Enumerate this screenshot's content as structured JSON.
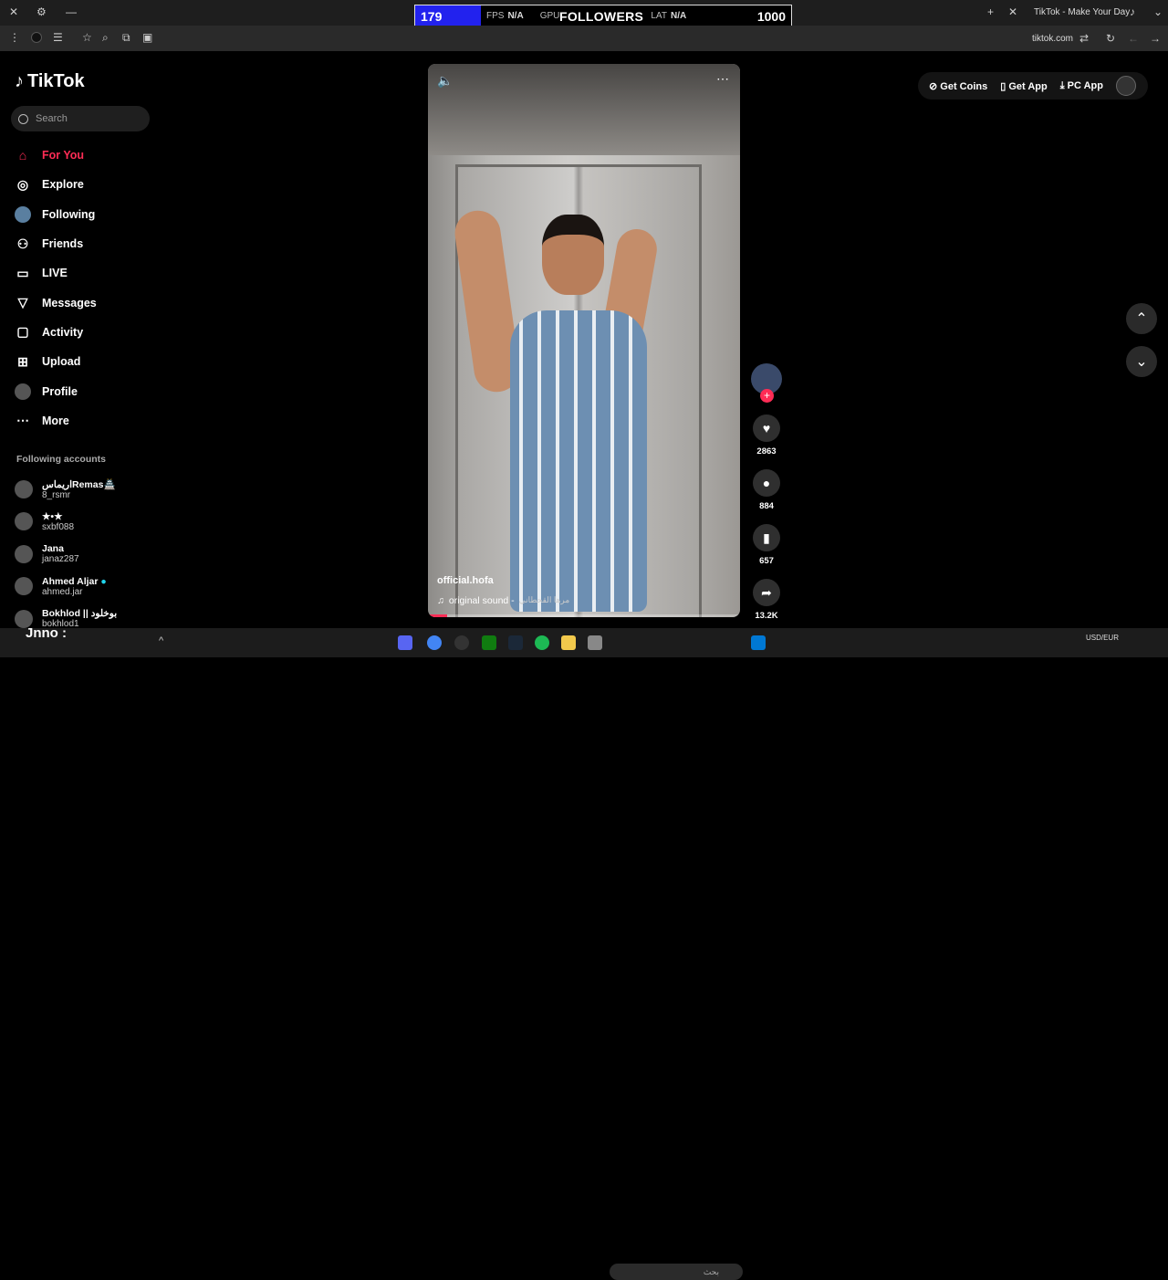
{
  "overlay": {
    "count": "179",
    "fps_label": "FPS",
    "fps_value": "N/A",
    "gpu_label": "GPU",
    "title": "FOLLOWERS",
    "lat_label": "LAT",
    "lat_value": "N/A",
    "goal": "1000"
  },
  "browser": {
    "tab_title": "TikTok - Make Your Day",
    "url": "tiktok.com"
  },
  "brand": {
    "name": "TikTok"
  },
  "search": {
    "placeholder": "Search"
  },
  "nav": [
    {
      "label": "For You",
      "icon": "home-icon"
    },
    {
      "label": "Explore",
      "icon": "compass-icon"
    },
    {
      "label": "Following",
      "icon": "following-avatar-icon"
    },
    {
      "label": "Friends",
      "icon": "friends-icon"
    },
    {
      "label": "LIVE",
      "icon": "live-tv-icon"
    },
    {
      "label": "Messages",
      "icon": "send-icon"
    },
    {
      "label": "Activity",
      "icon": "activity-icon"
    },
    {
      "label": "Upload",
      "icon": "plus-square-icon"
    },
    {
      "label": "Profile",
      "icon": "profile-avatar-icon"
    },
    {
      "label": "More",
      "icon": "more-icon"
    }
  ],
  "following_accounts": {
    "heading": "Following accounts",
    "items": [
      {
        "name": "اريماسRemas🏯",
        "user": "8_rsmr"
      },
      {
        "name": "★•★",
        "user": "sxbf088"
      },
      {
        "name": "Jana",
        "user": "janaz287"
      },
      {
        "name": "Ahmed Aljar",
        "user": "ahmed.jar"
      },
      {
        "name": "Bokhlod || بوخلود",
        "user": "bokhlod1"
      }
    ]
  },
  "video": {
    "author": "official.hofa",
    "sound": "original sound -",
    "sound_extra": "مرها القحطاني",
    "progress": 0.06
  },
  "actions": {
    "likes": "2863",
    "comments": "884",
    "saves": "657",
    "shares": "13.2K"
  },
  "top_actions": {
    "coins": "Get Coins",
    "app": "Get App",
    "pc": "PC App"
  },
  "taskbar": {
    "stream_name": "Jnno :",
    "search_text": "بحث",
    "currency": "USD/EUR"
  },
  "colors": {
    "accent": "#fe2c55",
    "background": "#000000"
  }
}
